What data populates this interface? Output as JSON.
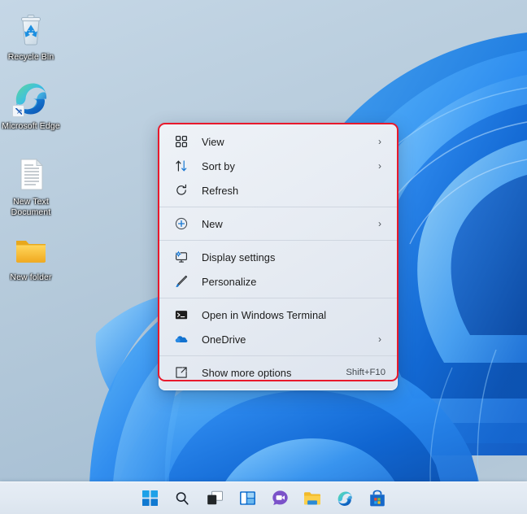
{
  "desktop": {
    "icons": [
      {
        "name": "recycle-bin",
        "label": "Recycle Bin"
      },
      {
        "name": "microsoft-edge",
        "label": "Microsoft Edge"
      },
      {
        "name": "new-text-document",
        "label": "New Text Document"
      },
      {
        "name": "new-folder",
        "label": "New folder"
      }
    ]
  },
  "context_menu": {
    "highlight_color": "#e8192c",
    "groups": [
      {
        "items": [
          {
            "label": "View",
            "icon": "grid-view-icon",
            "chevron": "›",
            "accel": ""
          },
          {
            "label": "Sort by",
            "icon": "sort-arrows-icon",
            "chevron": "›",
            "accel": ""
          },
          {
            "label": "Refresh",
            "icon": "refresh-icon",
            "chevron": "",
            "accel": ""
          }
        ]
      },
      {
        "items": [
          {
            "label": "New",
            "icon": "plus-circle-icon",
            "chevron": "›",
            "accel": ""
          }
        ]
      },
      {
        "items": [
          {
            "label": "Display settings",
            "icon": "monitor-settings-icon",
            "chevron": "",
            "accel": ""
          },
          {
            "label": "Personalize",
            "icon": "paintbrush-icon",
            "chevron": "",
            "accel": ""
          }
        ]
      },
      {
        "items": [
          {
            "label": "Open in Windows Terminal",
            "icon": "terminal-icon",
            "chevron": "",
            "accel": ""
          },
          {
            "label": "OneDrive",
            "icon": "cloud-icon",
            "chevron": "›",
            "accel": ""
          }
        ]
      },
      {
        "items": [
          {
            "label": "Show more options",
            "icon": "show-more-options-icon",
            "chevron": "",
            "accel": "Shift+F10"
          }
        ]
      }
    ]
  },
  "taskbar": {
    "buttons": [
      {
        "name": "start-button",
        "label": "Start"
      },
      {
        "name": "search-button",
        "label": "Search"
      },
      {
        "name": "task-view-button",
        "label": "Task View"
      },
      {
        "name": "widgets-button",
        "label": "Widgets"
      },
      {
        "name": "chat-button",
        "label": "Chat"
      },
      {
        "name": "file-explorer-button",
        "label": "File Explorer"
      },
      {
        "name": "microsoft-edge-button",
        "label": "Microsoft Edge"
      },
      {
        "name": "microsoft-store-button",
        "label": "Microsoft Store"
      }
    ]
  }
}
